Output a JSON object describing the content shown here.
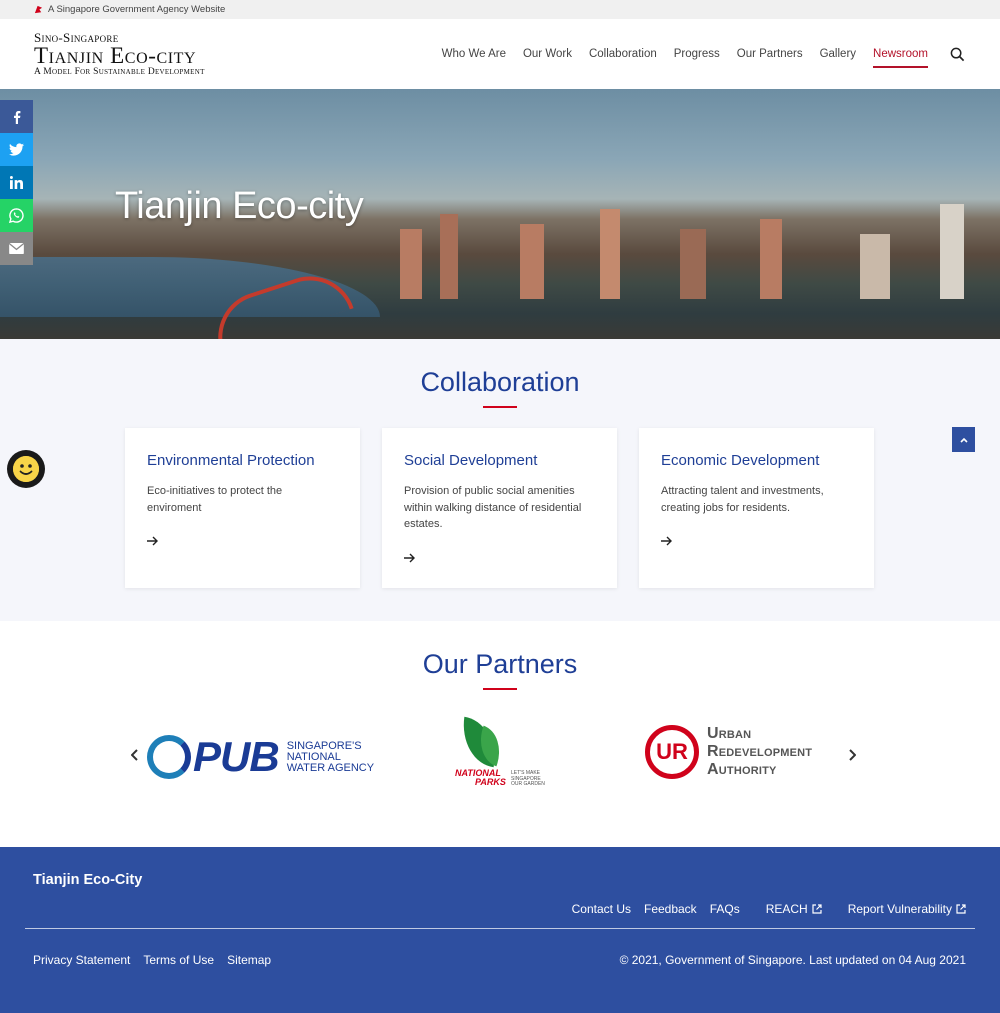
{
  "masthead": {
    "text": "A Singapore Government Agency Website"
  },
  "logo": {
    "line1": "Sino-Singapore",
    "line2": "Tianjin Eco-city",
    "line3": "A Model For Sustainable Development"
  },
  "nav": {
    "items": [
      {
        "label": "Who We Are"
      },
      {
        "label": "Our Work"
      },
      {
        "label": "Collaboration"
      },
      {
        "label": "Progress"
      },
      {
        "label": "Our Partners"
      },
      {
        "label": "Gallery"
      },
      {
        "label": "Newsroom",
        "active": true
      }
    ],
    "search_icon": "search-icon"
  },
  "hero": {
    "title": "Tianjin Eco-city"
  },
  "social": [
    "facebook-icon",
    "twitter-icon",
    "linkedin-icon",
    "whatsapp-icon",
    "email-icon"
  ],
  "collaboration": {
    "title": "Collaboration",
    "cards": [
      {
        "title": "Environmental Protection",
        "desc": "Eco-initiatives to protect the enviroment"
      },
      {
        "title": "Social Development",
        "desc": "Provision of public social amenities within walking distance of residential estates."
      },
      {
        "title": "Economic Development",
        "desc": "Attracting talent and investments, creating jobs for residents."
      }
    ]
  },
  "partners": {
    "title": "Our Partners",
    "pub": {
      "name": "PUB",
      "tagline_1": "SINGAPORE'S",
      "tagline_2": "NATIONAL",
      "tagline_3": "WATER AGENCY"
    },
    "nparks": {
      "line1": "NATIONAL",
      "line2": "PARKS",
      "tag1": "LET'S MAKE",
      "tag2": "SINGAPORE",
      "tag3": "OUR GARDEN"
    },
    "ura": {
      "mark": "UR",
      "line1": "Urban",
      "line2": "Redevelopment",
      "line3": "Authority"
    }
  },
  "footer": {
    "title": "Tianjin Eco-City",
    "links": [
      "Contact Us",
      "Feedback",
      "FAQs",
      "REACH",
      "Report Vulnerability"
    ],
    "bottom_links": [
      "Privacy Statement",
      "Terms of Use",
      "Sitemap"
    ],
    "copyright": "© 2021, Government of Singapore. Last updated on 04 Aug 2021"
  },
  "colors": {
    "brand_blue": "#2e4fa0",
    "title_blue": "#1f3f96",
    "accent_red": "#b3122a"
  }
}
